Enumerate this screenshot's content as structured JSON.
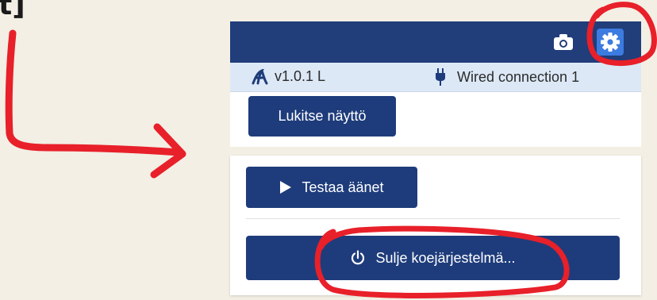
{
  "corner_text": "t]",
  "topbar": {
    "camera_icon": "camera-icon",
    "settings_icon": "gear-icon"
  },
  "infobar": {
    "app_logo_icon": "app-logo-icon",
    "version": "v1.0.1 L",
    "connection_icon": "ethernet-plug-icon",
    "connection_label": "Wired connection 1"
  },
  "lock_screen_label": "Lukitse näyttö",
  "menu": {
    "test_sounds_label": "Testaa äänet",
    "test_sounds_icon": "play-icon",
    "shutdown_label": "Sulje koejärjestelmä...",
    "shutdown_icon": "power-icon"
  },
  "colors": {
    "header": "#213d7a",
    "button": "#1e3c7b",
    "gear_button": "#3c7be0",
    "infobar": "#dce8f6",
    "annotation": "#e8202a",
    "background": "#f3efe4"
  }
}
